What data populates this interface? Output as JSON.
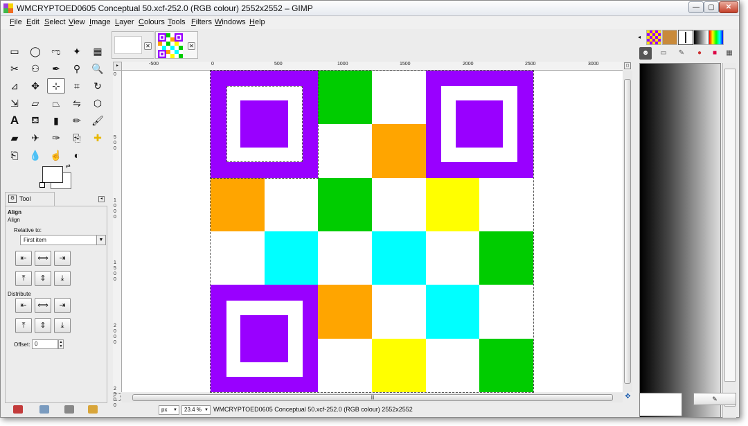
{
  "window": {
    "title": "WMCRYPTOED0605 Conceptual 50.xcf-252.0 (RGB colour) 2552x2552 – GIMP"
  },
  "menubar": [
    {
      "key": "F",
      "rest": "ile"
    },
    {
      "key": "E",
      "rest": "dit"
    },
    {
      "key": "S",
      "rest": "elect"
    },
    {
      "key": "V",
      "rest": "iew"
    },
    {
      "key": "I",
      "rest": "mage"
    },
    {
      "key": "L",
      "rest": "ayer"
    },
    {
      "key": "C",
      "rest": "olours"
    },
    {
      "key": "T",
      "rest": "ools"
    },
    {
      "key": "F",
      "rest": "ilters"
    },
    {
      "key": "W",
      "rest": "indows"
    },
    {
      "key": "H",
      "rest": "elp"
    }
  ],
  "tool_options": {
    "tab_label": "Tool Options",
    "tool_name": "Align",
    "tool_sub": "Align",
    "relative_to_label": "Relative to:",
    "relative_to_value": "First item",
    "distribute_label": "Distribute",
    "offset_label": "Offset:",
    "offset_value": "0"
  },
  "ruler": {
    "h_ticks": [
      "-500",
      "0",
      "500",
      "1000",
      "1500",
      "2000",
      "2500",
      "3000"
    ],
    "v_ticks": [
      "0",
      "500",
      "1000",
      "1500",
      "2000",
      "2500"
    ]
  },
  "status": {
    "unit": "px",
    "zoom": "23.4 %",
    "text": "WMCRYPTOED0605 Conceptual 50.xcf-252.0 (RGB colour) 2552x2552"
  },
  "colors": {
    "purple": "#9900ff",
    "green": "#00cc00",
    "orange": "#ffa500",
    "yellow": "#ffff00",
    "cyan": "#00ffff",
    "white": "#ffffff"
  },
  "grid": {
    "rows": 6,
    "cols": 6,
    "cells": [
      [
        "F",
        "F",
        "green",
        "white",
        "F",
        "F"
      ],
      [
        "F",
        "F",
        "white",
        "orange",
        "F",
        "F"
      ],
      [
        "orange",
        "white",
        "green",
        "white",
        "yellow",
        "white"
      ],
      [
        "white",
        "cyan",
        "white",
        "cyan",
        "white",
        "green"
      ],
      [
        "F",
        "F",
        "orange",
        "white",
        "cyan",
        "white"
      ],
      [
        "F",
        "F",
        "white",
        "yellow",
        "white",
        "green"
      ]
    ]
  }
}
